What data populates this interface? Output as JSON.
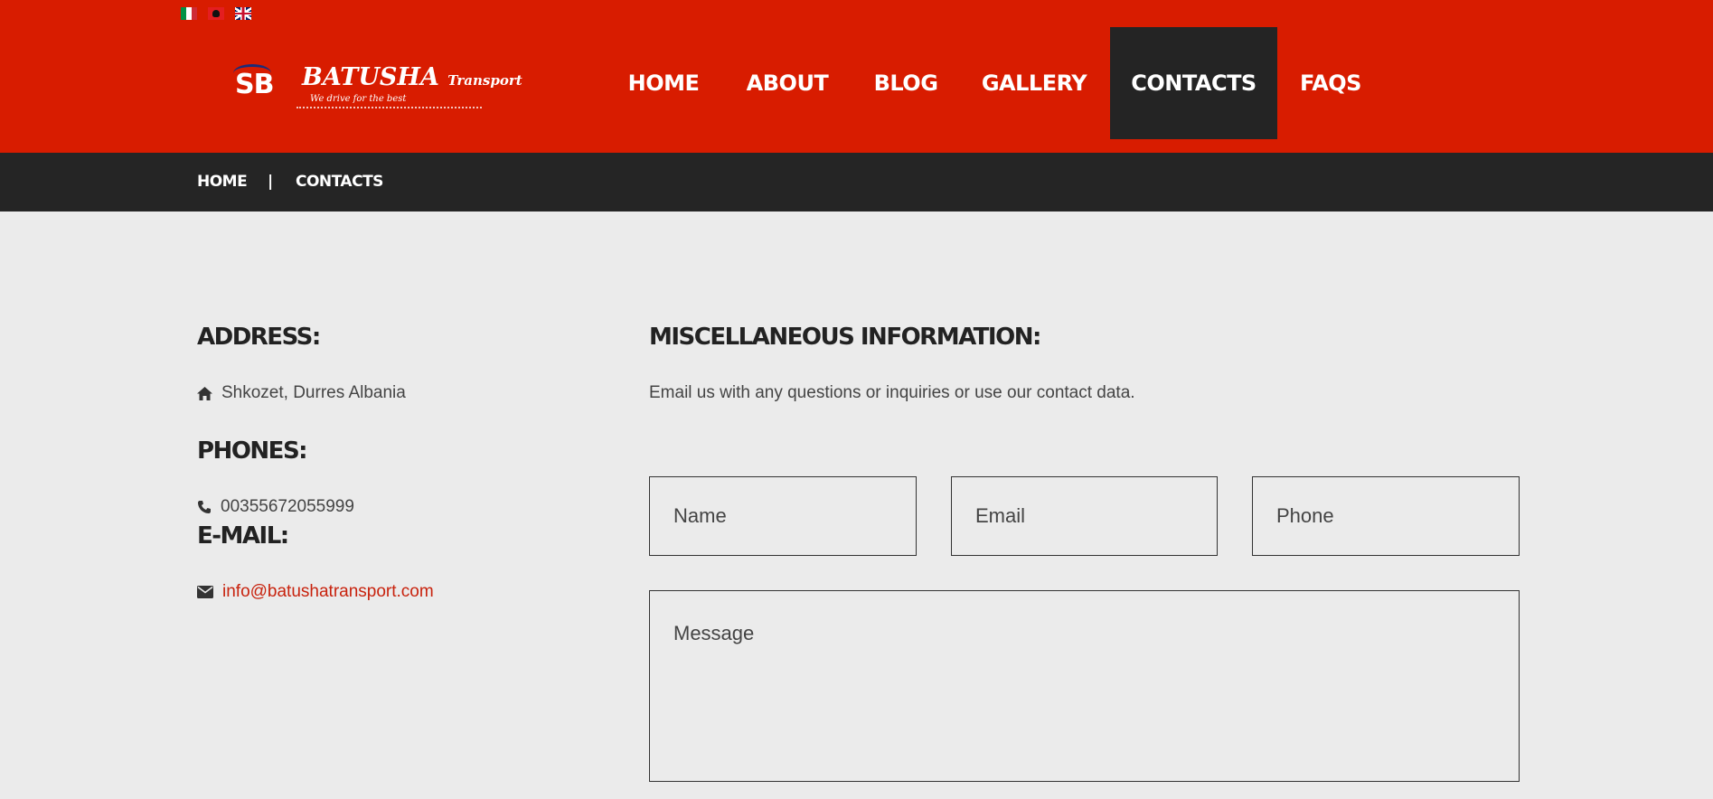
{
  "header": {
    "languages": [
      {
        "name": "italian-flag",
        "label": "Italiano"
      },
      {
        "name": "albanian-flag",
        "label": "Shqip"
      },
      {
        "name": "english-flag",
        "label": "English"
      }
    ],
    "logo": {
      "mark": "SB",
      "name": "BATUSHA",
      "name_suffix": "Transport",
      "tagline": "We drive for the best"
    },
    "nav": [
      {
        "label": "HOME",
        "active": false
      },
      {
        "label": "ABOUT",
        "active": false
      },
      {
        "label": "BLOG",
        "active": false
      },
      {
        "label": "GALLERY",
        "active": false
      },
      {
        "label": "CONTACTS",
        "active": true
      },
      {
        "label": "FAQS",
        "active": false
      }
    ]
  },
  "breadcrumb": {
    "home": "HOME",
    "separator": "|",
    "current": "CONTACTS"
  },
  "contact": {
    "address_heading": "ADDRESS:",
    "address": "Shkozet, Durres Albania",
    "phones_heading": "PHONES:",
    "phone": "00355672055999",
    "email_heading": "E-MAIL:",
    "email": "info@batushatransport.com"
  },
  "misc": {
    "heading": "MISCELLANEOUS INFORMATION:",
    "description": "Email us with any questions or inquiries or use our contact data."
  },
  "form": {
    "name_placeholder": "Name",
    "email_placeholder": "Email",
    "phone_placeholder": "Phone",
    "message_placeholder": "Message"
  },
  "colors": {
    "brand_red": "#d81c00",
    "dark_bar": "#252525",
    "link": "#c8230e",
    "background": "#ebebeb"
  }
}
